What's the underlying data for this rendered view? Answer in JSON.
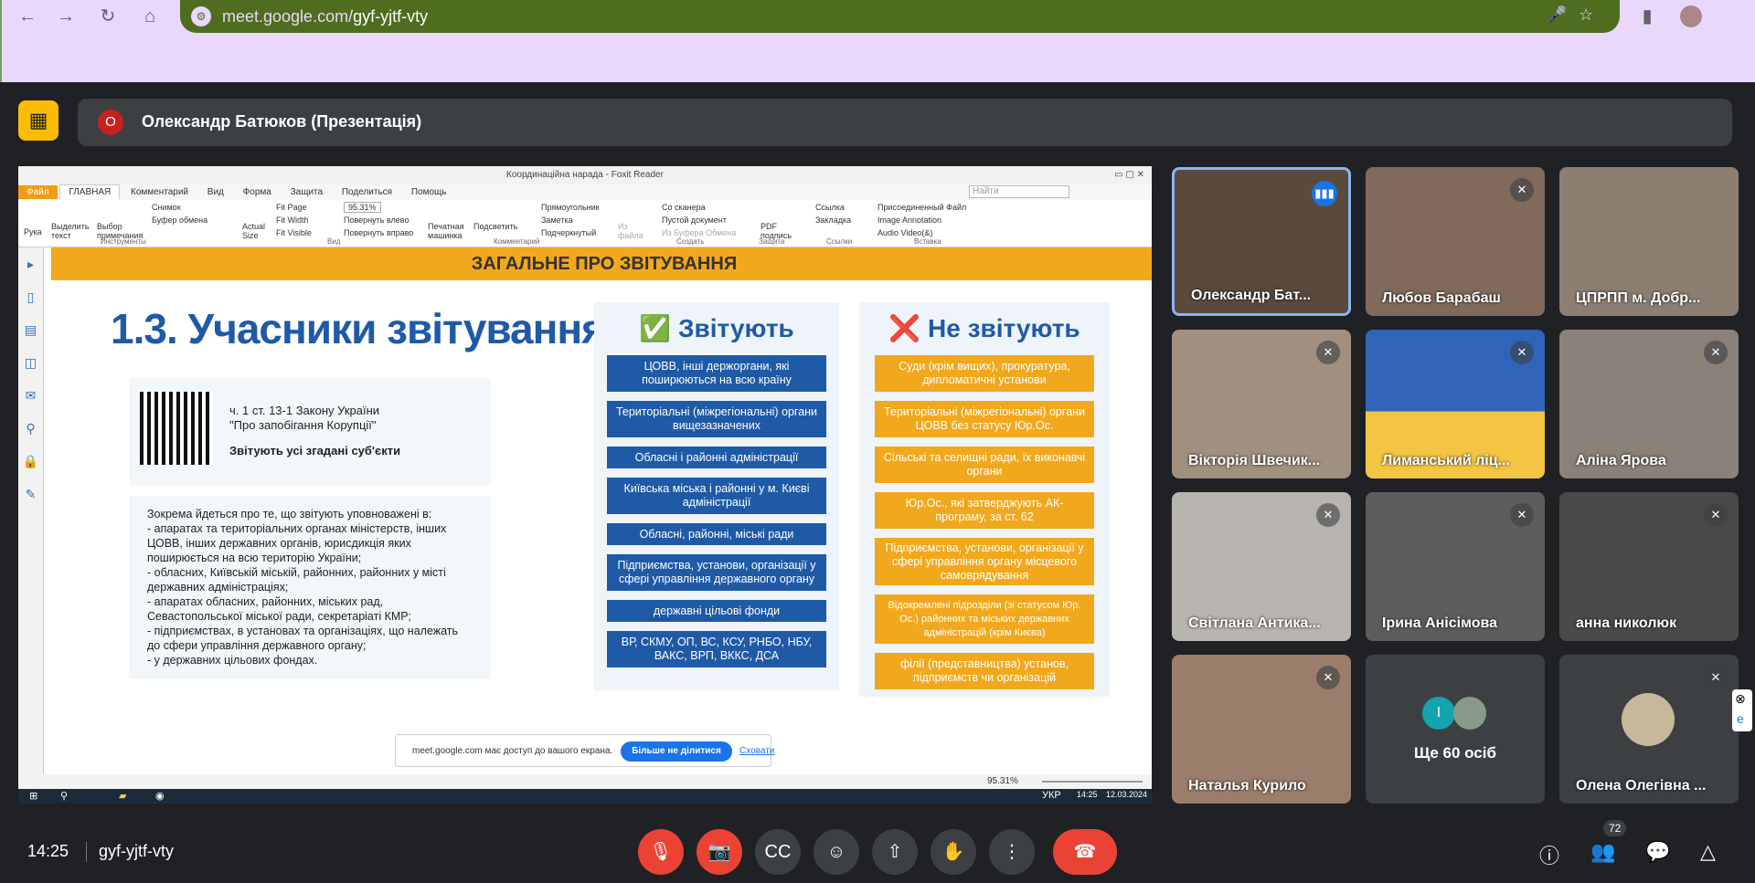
{
  "browser": {
    "url_domain": "meet.google.com/",
    "url_path": "gyf-yjtf-vty"
  },
  "presentation": {
    "presenter_initial": "О",
    "title": "Олександр Батюков (Презентація)"
  },
  "foxit": {
    "window_title": "Координаційна нарада - Foxit Reader",
    "tabs": [
      "Файл",
      "ГЛАВНАЯ",
      "Комментарий",
      "Вид",
      "Форма",
      "Защита",
      "Поделиться",
      "Помощь"
    ],
    "search_placeholder": "Найти",
    "ribbon": {
      "hand": "Рука",
      "select_text": "Выделить текст",
      "select_note": "Выбор примечания",
      "snapshot": "Снимок",
      "clipboard": "Буфер обмена",
      "group_tools": "Инструменты",
      "actual_size": "Actual Size",
      "fit_page": "Fit Page",
      "fit_width": "Fit Width",
      "fit_visible": "Fit Visible",
      "zoom": "95.31%",
      "rotate_left": "Повернуть влево",
      "rotate_right": "Повернуть вправо",
      "group_view": "Вид",
      "typewriter": "Печатная машинка",
      "highlight": "Подсветить",
      "rectangle": "Прямоугольник",
      "note": "Заметка",
      "underline": "Подчеркнутый",
      "group_comment": "Комментарий",
      "from_file": "Из файла",
      "scanner": "Со сканера",
      "blank_doc": "Пустой документ",
      "from_clipboard": "Из Буфера Обмена",
      "group_create": "Создать",
      "pdf_sign": "PDF подпись",
      "group_protect": "Защита",
      "link": "Ссылка",
      "bookmark": "Закладка",
      "group_links": "Ссылки",
      "attached_file": "Присоединенный Файл",
      "image_annotation": "Image Annotation",
      "audio_video": "Audio Video(&)",
      "group_insert": "Вставка"
    },
    "status_zoom": "95.31%"
  },
  "slide": {
    "header": "ЗАГАЛЬНЕ ПРО ЗВІТУВАННЯ",
    "title": "1.3. Учасники звітування",
    "law_line1": "ч. 1 ст. 13-1 Закону України",
    "law_line2": "\"Про запобігання Корупції\"",
    "all_report": "Звітують усі згадані суб'єкти",
    "desc_lines": [
      "Зокрема йдеться про те, що звітують уповноважені в:",
      "- апаратах та територіальних органах міністерств, інших",
      "ЦОВВ, інших державних органів, юрисдикція яких",
      "поширюється на всю територію України;",
      "- обласних, Київській міській, районних, районних у місті",
      "державних адміністраціях;",
      " - апаратах обласних, районних, міських рад,",
      "Севастопольської міської ради, секретаріаті КМР;",
      " - підприємствах, в установах та організаціях, що належать",
      "до сфери управління державного органу;",
      " - у державних цільових фондах."
    ],
    "yes_mark": "✅",
    "yes_title": "Звітують",
    "yes_items": [
      "ЦОВВ, інші держоргани, які поширюються на всю країну",
      "Територіальні (міжрегіональні) органи вищезазначених",
      "Обласні і районні адміністрації",
      "Київська міська і районні у м. Києві адміністрації",
      "Обласні, районні, міські ради",
      "Підприємства, установи, організації у сфері управління державного органу",
      "державні цільові фонди",
      "ВР, СКМУ, ОП, ВС, КСУ, РНБО, НБУ, ВАКС, ВРП, ВККС, ДСА"
    ],
    "no_mark": "❌",
    "no_title": "Не звітують",
    "no_items": [
      "Суди (крім вищих), прокуратура, дипломатичні установи",
      "Територіальні (міжрегіональні) органи ЦОВВ без статусу Юр.Ос.",
      "Сільські та селищні ради, їх виконавчі органи",
      "Юр.Ос., які затверджують АК-програму, за ст. 62",
      "Підприємства, установи, організації у сфері управління органу місцевого самоврядування",
      "Відокремлені підрозділи (зі статусом Юр. Ос.) районних та міських державних адміністрацій (крім Києва)",
      "філії (представництва) установ, підприємств чи організацій"
    ]
  },
  "share_popup": {
    "message": "meet.google.com має доступ до вашого екрана.",
    "stop": "Більше не ділитися",
    "hide": "Сховати"
  },
  "taskbar": {
    "lang": "УКР",
    "time": "14:25",
    "date": "12.03.2024"
  },
  "participants": [
    {
      "name": "Олександр Бат...",
      "state": "speaking"
    },
    {
      "name": "Любов Барабаш",
      "state": "muted"
    },
    {
      "name": "ЦПРПП м. Добр...",
      "state": "none"
    },
    {
      "name": "Вікторія Швечик...",
      "state": "muted"
    },
    {
      "name": "Лиманський ліц...",
      "state": "muted"
    },
    {
      "name": "Аліна Ярова",
      "state": "muted"
    },
    {
      "name": "Світлана Антика...",
      "state": "muted"
    },
    {
      "name": "Ірина Анісімова",
      "state": "muted"
    },
    {
      "name": "анна николюк",
      "state": "muted"
    },
    {
      "name": "Наталья Курило",
      "state": "muted"
    },
    {
      "name": "Ще 60 осіб",
      "state": "group",
      "initial": "І"
    },
    {
      "name": "Олена Олегівна ...",
      "state": "muted"
    }
  ],
  "bottom_bar": {
    "time": "14:25",
    "meeting_code": "gyf-yjtf-vty",
    "people_count": "72"
  },
  "colors": {
    "meet_bg": "#202124",
    "end_call": "#ea4335",
    "accent_blue": "#1a73e8",
    "slide_orange": "#f2a81d",
    "slide_blue": "#1f5aa6"
  }
}
